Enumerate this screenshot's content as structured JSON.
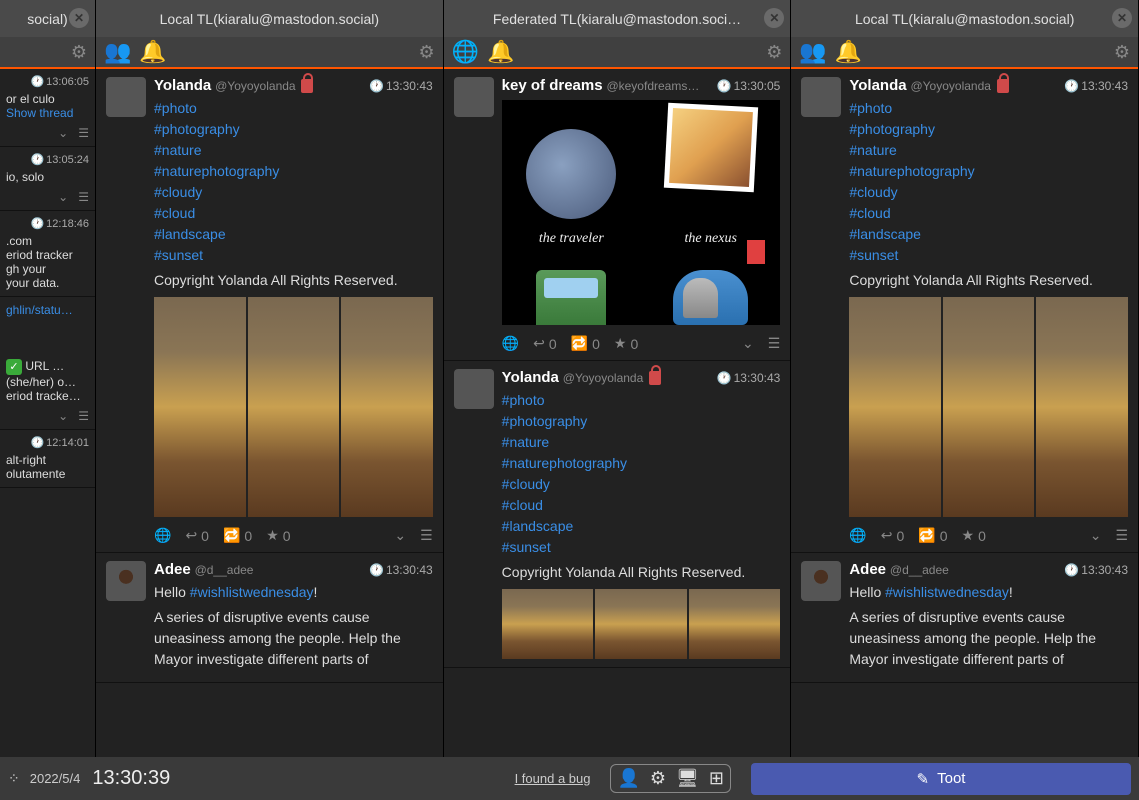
{
  "columns": {
    "narrow": {
      "title": "social)",
      "items": [
        {
          "ts": "13:06:05",
          "text": "or el culo",
          "show_thread": "Show thread"
        },
        {
          "ts": "13:05:24",
          "text": "io, solo"
        },
        {
          "ts": "12:18:46",
          "text": ".com",
          "lines": [
            "eriod tracker",
            "gh your",
            "your data."
          ]
        },
        {
          "link": "ghlin/statu…",
          "lines2": [
            "URL …",
            "(she/her) o…",
            "eriod tracke…"
          ]
        },
        {
          "ts": "12:14:01",
          "text": "alt-right",
          "text2": "olutamente"
        }
      ]
    },
    "local1": {
      "title": "Local TL(kiaralu@mastodon.social)"
    },
    "federated": {
      "title": "Federated TL(kiaralu@mastodon.soci…"
    },
    "local2": {
      "title": "Local TL(kiaralu@mastodon.social)"
    }
  },
  "posts": {
    "yolanda": {
      "name": "Yolanda",
      "handle": "@Yoyoyolanda",
      "time": "13:30:43",
      "tags": [
        "#photo",
        "#photography",
        "#nature",
        "#naturephotography",
        "#cloudy",
        "#cloud",
        "#landscape",
        "#sunset"
      ],
      "copyright": "Copyright Yolanda All Rights Reserved.",
      "replies": "0",
      "boosts": "0",
      "favs": "0"
    },
    "kod": {
      "name": "key of dreams",
      "handle": "@keyofdreams…",
      "time": "13:30:05",
      "labels": {
        "left": "the traveler",
        "right": "the nexus"
      },
      "replies": "0",
      "boosts": "0",
      "favs": "0"
    },
    "adee": {
      "name": "Adee",
      "handle": "@d__adee",
      "time": "13:30:43",
      "hello": "Hello ",
      "tag": "#wishlistwednesday",
      "excl": "!",
      "body": "A series of disruptive events cause uneasiness among the people. Help the Mayor investigate different parts of "
    }
  },
  "bottombar": {
    "date": "2022/5/4",
    "time": "13:30:39",
    "bug": "I found a bug",
    "toot": "Toot"
  }
}
